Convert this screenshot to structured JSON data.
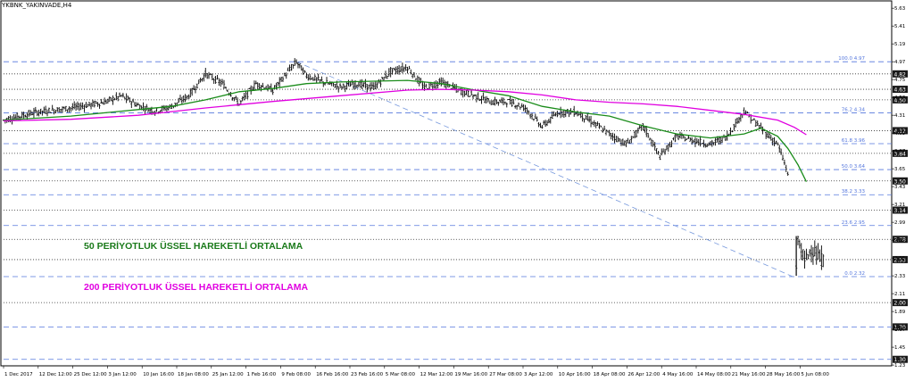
{
  "window": {
    "title": "YKBNK_YAKINVADE,H4"
  },
  "annotations": [
    {
      "text": "50 PERİYOTLUK ÜSSEL HAREKETLİ ORTALAMA",
      "color": "#1a7a1a"
    },
    {
      "text": "200 PERİYOTLUK ÜSSEL HAREKETLİ ORTALAMA",
      "color": "#e100e1"
    }
  ],
  "colors": {
    "ema50": "#1a8c1a",
    "ema200": "#e000e0",
    "candles": "#000000",
    "fib": "#5577dd",
    "levels": "#333333",
    "trend": "#7799dd"
  },
  "chart_data": {
    "type": "line",
    "title": "YKBNK_YAKINVADE,H4",
    "ylim": [
      1.22,
      5.72
    ],
    "y_ticks": [
      5.63,
      5.41,
      5.19,
      4.97,
      4.75,
      4.53,
      4.31,
      4.09,
      3.87,
      3.65,
      3.43,
      3.21,
      2.99,
      2.77,
      2.55,
      2.33,
      2.11,
      1.89,
      1.67,
      1.45,
      1.23
    ],
    "x_labels": [
      "1 Dec 2017",
      "12 Dec 12:00",
      "25 Dec 12:00",
      "3 Jan 12:00",
      "10 Jan 16:00",
      "18 Jan 08:00",
      "25 Jan 12:00",
      "1 Feb 16:00",
      "9 Feb 08:00",
      "16 Feb 16:00",
      "23 Feb 16:00",
      "5 Mar 08:00",
      "12 Mar 12:00",
      "19 Mar 16:00",
      "27 Mar 08:00",
      "3 Apr 12:00",
      "10 Apr 16:00",
      "18 Apr 08:00",
      "26 Apr 12:00",
      "4 May 16:00",
      "14 May 08:00",
      "21 May 16:00",
      "28 May 16:00",
      "5 Jun 08:00"
    ],
    "price_series": [
      {
        "x": 0,
        "y": 4.25
      },
      {
        "x": 1,
        "y": 4.35
      },
      {
        "x": 2,
        "y": 4.4
      },
      {
        "x": 3,
        "y": 4.47
      },
      {
        "x": 3.5,
        "y": 4.55
      },
      {
        "x": 4,
        "y": 4.43
      },
      {
        "x": 4.5,
        "y": 4.36
      },
      {
        "x": 5,
        "y": 4.42
      },
      {
        "x": 5.5,
        "y": 4.55
      },
      {
        "x": 6,
        "y": 4.82
      },
      {
        "x": 6.5,
        "y": 4.7
      },
      {
        "x": 7,
        "y": 4.45
      },
      {
        "x": 7.5,
        "y": 4.7
      },
      {
        "x": 8,
        "y": 4.62
      },
      {
        "x": 8.7,
        "y": 4.97
      },
      {
        "x": 9,
        "y": 4.8
      },
      {
        "x": 9.5,
        "y": 4.72
      },
      {
        "x": 10,
        "y": 4.66
      },
      {
        "x": 10.5,
        "y": 4.7
      },
      {
        "x": 11,
        "y": 4.65
      },
      {
        "x": 11.5,
        "y": 4.85
      },
      {
        "x": 12,
        "y": 4.9
      },
      {
        "x": 12.5,
        "y": 4.65
      },
      {
        "x": 13,
        "y": 4.72
      },
      {
        "x": 13.5,
        "y": 4.62
      },
      {
        "x": 14,
        "y": 4.55
      },
      {
        "x": 14.5,
        "y": 4.47
      },
      {
        "x": 15,
        "y": 4.48
      },
      {
        "x": 15.5,
        "y": 4.4
      },
      {
        "x": 16,
        "y": 4.17
      },
      {
        "x": 16.5,
        "y": 4.35
      },
      {
        "x": 17,
        "y": 4.35
      },
      {
        "x": 17.5,
        "y": 4.22
      },
      {
        "x": 18,
        "y": 4.08
      },
      {
        "x": 18.5,
        "y": 3.95
      },
      {
        "x": 19,
        "y": 4.18
      },
      {
        "x": 19.5,
        "y": 3.8
      },
      {
        "x": 20,
        "y": 4.05
      },
      {
        "x": 20.5,
        "y": 4.0
      },
      {
        "x": 21,
        "y": 3.95
      },
      {
        "x": 21.5,
        "y": 4.05
      },
      {
        "x": 22,
        "y": 4.36
      },
      {
        "x": 22.5,
        "y": 4.15
      },
      {
        "x": 23,
        "y": 3.95
      },
      {
        "x": 23.3,
        "y": 3.6
      },
      {
        "x": 23.55,
        "y": 2.38
      },
      {
        "x": 23.6,
        "y": 2.8
      },
      {
        "x": 23.8,
        "y": 2.5
      },
      {
        "x": 24,
        "y": 2.68
      },
      {
        "x": 24.2,
        "y": 2.55
      },
      {
        "x": 24.4,
        "y": 2.52
      }
    ],
    "series": [
      {
        "name": "50 PERİYOTLUK ÜSSEL HAREKETLİ ORTALAMA",
        "points": [
          {
            "x": 0,
            "y": 4.25
          },
          {
            "x": 2,
            "y": 4.3
          },
          {
            "x": 4,
            "y": 4.38
          },
          {
            "x": 5,
            "y": 4.42
          },
          {
            "x": 6,
            "y": 4.5
          },
          {
            "x": 7,
            "y": 4.6
          },
          {
            "x": 8,
            "y": 4.64
          },
          {
            "x": 9,
            "y": 4.7
          },
          {
            "x": 10,
            "y": 4.72
          },
          {
            "x": 11,
            "y": 4.73
          },
          {
            "x": 12,
            "y": 4.74
          },
          {
            "x": 12.5,
            "y": 4.72
          },
          {
            "x": 13,
            "y": 4.7
          },
          {
            "x": 14,
            "y": 4.62
          },
          {
            "x": 15,
            "y": 4.55
          },
          {
            "x": 16,
            "y": 4.42
          },
          {
            "x": 17,
            "y": 4.35
          },
          {
            "x": 18,
            "y": 4.3
          },
          {
            "x": 19,
            "y": 4.18
          },
          {
            "x": 20,
            "y": 4.08
          },
          {
            "x": 21,
            "y": 4.03
          },
          {
            "x": 22,
            "y": 4.08
          },
          {
            "x": 22.5,
            "y": 4.15
          },
          {
            "x": 23,
            "y": 4.05
          },
          {
            "x": 23.3,
            "y": 3.9
          },
          {
            "x": 23.6,
            "y": 3.7
          },
          {
            "x": 23.85,
            "y": 3.49
          }
        ]
      },
      {
        "name": "200 PERİYOTLUK ÜSSEL HAREKETLİ ORTALAMA",
        "points": [
          {
            "x": 0,
            "y": 4.24
          },
          {
            "x": 2,
            "y": 4.26
          },
          {
            "x": 4,
            "y": 4.31
          },
          {
            "x": 6,
            "y": 4.4
          },
          {
            "x": 8,
            "y": 4.48
          },
          {
            "x": 10,
            "y": 4.55
          },
          {
            "x": 12,
            "y": 4.62
          },
          {
            "x": 13,
            "y": 4.63
          },
          {
            "x": 14,
            "y": 4.62
          },
          {
            "x": 15,
            "y": 4.6
          },
          {
            "x": 16,
            "y": 4.56
          },
          {
            "x": 17,
            "y": 4.5
          },
          {
            "x": 18,
            "y": 4.47
          },
          {
            "x": 19,
            "y": 4.45
          },
          {
            "x": 20,
            "y": 4.42
          },
          {
            "x": 21,
            "y": 4.37
          },
          {
            "x": 22,
            "y": 4.32
          },
          {
            "x": 23,
            "y": 4.25
          },
          {
            "x": 23.5,
            "y": 4.16
          },
          {
            "x": 23.85,
            "y": 4.07
          }
        ]
      }
    ],
    "horizontal_levels": [
      {
        "value": 4.97,
        "style": "dashed",
        "color": "fib",
        "label": "100.0 4.97"
      },
      {
        "value": 4.82,
        "style": "dotted",
        "color": "levels",
        "box": "4.82"
      },
      {
        "value": 4.63,
        "style": "dotted",
        "color": "levels",
        "box": "4.63"
      },
      {
        "value": 4.5,
        "style": "dotted",
        "color": "levels",
        "box": "4.50"
      },
      {
        "value": 4.34,
        "style": "dashed",
        "color": "fib",
        "label": "76.2 4.34"
      },
      {
        "value": 4.12,
        "style": "dotted",
        "color": "levels",
        "box": "4.12"
      },
      {
        "value": 3.96,
        "style": "dashed",
        "color": "fib",
        "label": "61.8 3.96"
      },
      {
        "value": 3.84,
        "style": "dotted",
        "color": "levels",
        "box": "3.84"
      },
      {
        "value": 3.64,
        "style": "dashed",
        "color": "fib",
        "label": "50.0 3.64"
      },
      {
        "value": 3.5,
        "style": "dotted",
        "color": "levels",
        "box": "3.50"
      },
      {
        "value": 3.33,
        "style": "dashed",
        "color": "fib",
        "label": "38.2 3.33"
      },
      {
        "value": 3.14,
        "style": "dotted",
        "color": "levels",
        "box": "3.14"
      },
      {
        "value": 2.95,
        "style": "dashed",
        "color": "fib",
        "label": "23.6 2.95"
      },
      {
        "value": 2.78,
        "style": "dotted",
        "color": "levels",
        "box": "2.78"
      },
      {
        "value": 2.53,
        "style": "dotted",
        "color": "levels",
        "box": "2.53"
      },
      {
        "value": 2.32,
        "style": "dashed",
        "color": "fib",
        "label": "0.0 2.32"
      },
      {
        "value": 2.0,
        "style": "dotted",
        "color": "levels",
        "box": "2.00"
      },
      {
        "value": 1.7,
        "style": "dashed",
        "color": "fib",
        "box": "1.70"
      },
      {
        "value": 1.3,
        "style": "dashed",
        "color": "fib",
        "box": "1.30"
      }
    ],
    "trend_line": [
      {
        "x": 8.7,
        "y": 4.97
      },
      {
        "x": 23.45,
        "y": 2.32
      }
    ],
    "grid": false
  }
}
